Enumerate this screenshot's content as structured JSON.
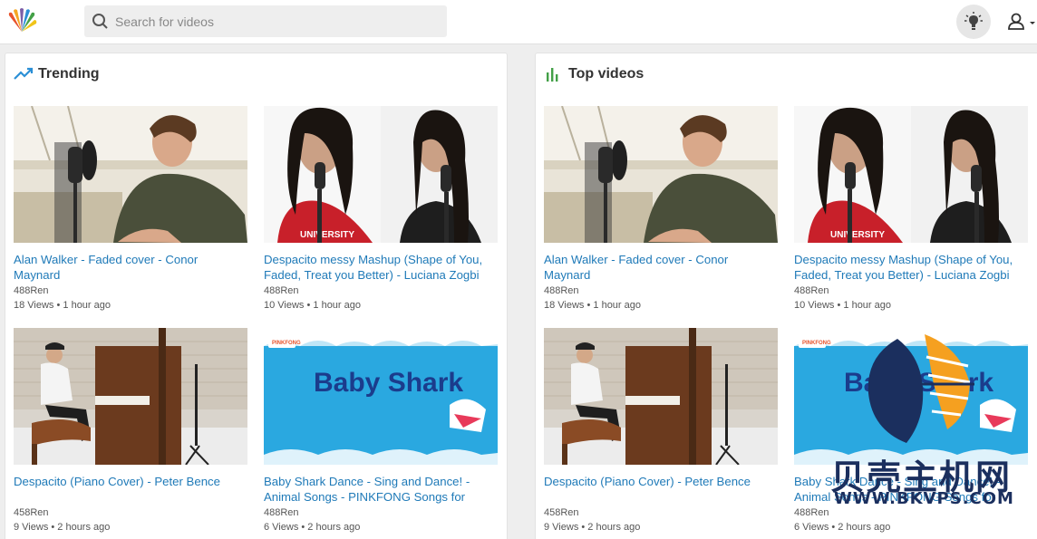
{
  "header": {
    "search_placeholder": "Search for videos",
    "logo_icon": "peacock-logo-icon",
    "theme_icon": "lightbulb-icon",
    "account_icon": "account-icon"
  },
  "colors": {
    "link": "#1f7ab8",
    "trending_icon": "#2b8fd6",
    "top_icon": "#43a047"
  },
  "trending": {
    "title": "Trending",
    "videos": [
      {
        "title": "Alan Walker - Faded cover - Conor Maynard",
        "channel": "488Ren",
        "meta": "18 Views • 1 hour ago"
      },
      {
        "title": "Despacito messy Mashup (Shape of You, Faded, Treat you Better) - Luciana Zogbi",
        "channel": "488Ren",
        "meta": "10 Views • 1 hour ago"
      },
      {
        "title": "Despacito (Piano Cover) - Peter Bence",
        "channel": "458Ren",
        "meta": "9 Views • 2 hours ago"
      },
      {
        "title": "Baby Shark Dance - Sing and Dance! - Animal Songs - PINKFONG Songs for",
        "channel": "488Ren",
        "meta": "6 Views • 2 hours ago"
      }
    ]
  },
  "top": {
    "title": "Top videos",
    "videos": [
      {
        "title": "Alan Walker - Faded cover - Conor Maynard",
        "channel": "488Ren",
        "meta": "18 Views • 1 hour ago"
      },
      {
        "title": "Despacito messy Mashup (Shape of You, Faded, Treat you Better) - Luciana Zogbi",
        "channel": "488Ren",
        "meta": "10 Views • 1 hour ago"
      },
      {
        "title": "Despacito (Piano Cover) - Peter Bence",
        "channel": "458Ren",
        "meta": "9 Views • 2 hours ago"
      },
      {
        "title": "Baby Shark Dance - Sing and Dance! - Animal Songs - PINKFONG Songs for",
        "channel": "488Ren",
        "meta": "6 Views • 2 hours ago"
      }
    ]
  },
  "thumbnails": {
    "baby_shark_text": "Baby Shark",
    "pinkfong_label": "PINKFONG"
  },
  "watermark": {
    "text": "贝壳主机网",
    "url": "WWW.BKVPS.COM"
  }
}
